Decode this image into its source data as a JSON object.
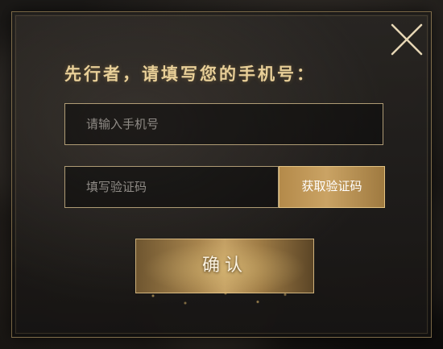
{
  "dialog": {
    "prompt": "先行者，请填写您的手机号：",
    "close_icon": "close-icon",
    "phone": {
      "placeholder": "请输入手机号",
      "value": ""
    },
    "code": {
      "placeholder": "填写验证码",
      "value": ""
    },
    "get_code_label": "获取验证码",
    "confirm_label": "确认"
  },
  "colors": {
    "accent_gold": "#caa364",
    "prompt_text": "#e8cf98",
    "border": "#e1c896"
  }
}
